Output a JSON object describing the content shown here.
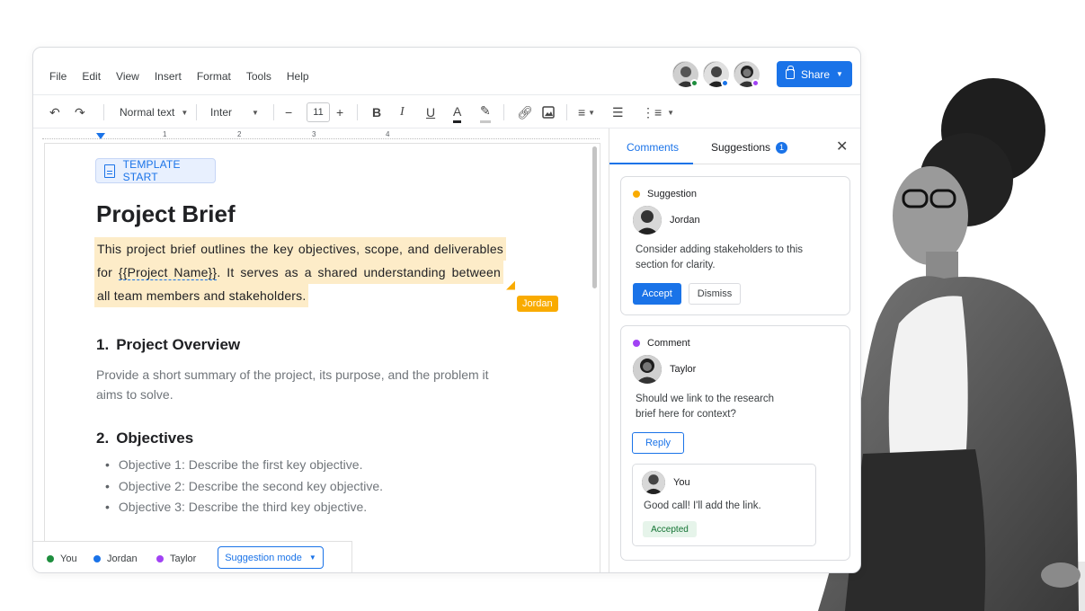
{
  "menu": [
    "File",
    "Edit",
    "View",
    "Insert",
    "Format",
    "Tools",
    "Help"
  ],
  "collaborators": [
    {
      "name": "You",
      "status_color": "#1e8e3e"
    },
    {
      "name": "Jordan",
      "status_color": "#1a73e8"
    },
    {
      "name": "Taylor",
      "status_color": "#a142f4"
    }
  ],
  "share": {
    "label": "Share"
  },
  "toolbar": {
    "style": "Normal text",
    "font": "Inter",
    "font_size": "11",
    "icons": [
      "undo-icon",
      "redo-icon",
      "bold-icon",
      "italic-icon",
      "underline-icon",
      "text-color-icon",
      "highlight-icon",
      "link-icon",
      "image-icon",
      "align-icon",
      "bulleted-list-icon",
      "numbered-list-icon"
    ]
  },
  "ruler": {
    "numbers": [
      "1",
      "2",
      "3",
      "4"
    ]
  },
  "doc": {
    "chip": "TEMPLATE START",
    "title": "Project Brief",
    "intro_line1": "This project brief outlines the key objectives, scope, and deliverables",
    "intro_line2_pre": "for ",
    "intro_token": "{{Project Name}}",
    "intro_line2_post": ". It serves as a shared understanding between",
    "intro_line3": "all team members and stakeholders.",
    "cursor_label": "Jordan",
    "section1_num": "1.",
    "section1_title": "Project Overview",
    "section1_text": "Provide a short summary of the project, its purpose, and the problem it aims to solve.",
    "section2_num": "2.",
    "section2_title": "Objectives",
    "objectives": [
      "Objective 1:  Describe the first key objective.",
      "Objective 2:  Describe the second key objective.",
      "Objective 3:  Describe the third key objective."
    ]
  },
  "statusbar": {
    "users": [
      {
        "name": "You",
        "color": "#1e8e3e"
      },
      {
        "name": "Jordan",
        "color": "#1a73e8"
      },
      {
        "name": "Taylor",
        "color": "#a142f4"
      }
    ],
    "mode": "Suggestion mode"
  },
  "sidepanel": {
    "tab_comments": "Comments",
    "tab_suggestions": "Suggestions",
    "suggestions_count": "1",
    "suggestion": {
      "type": "Suggestion",
      "type_color": "#f9ab00",
      "user": "Jordan",
      "text": "Consider adding stakeholders to this section for clarity.",
      "accept": "Accept",
      "dismiss": "Dismiss"
    },
    "comment": {
      "type": "Comment",
      "type_color": "#a142f4",
      "user": "Taylor",
      "text": "Should we link to the research brief here for context?",
      "reply": "Reply",
      "reply_user": "You",
      "reply_text": "Good call! I'll add the link.",
      "reply_status": "Accepted"
    }
  }
}
